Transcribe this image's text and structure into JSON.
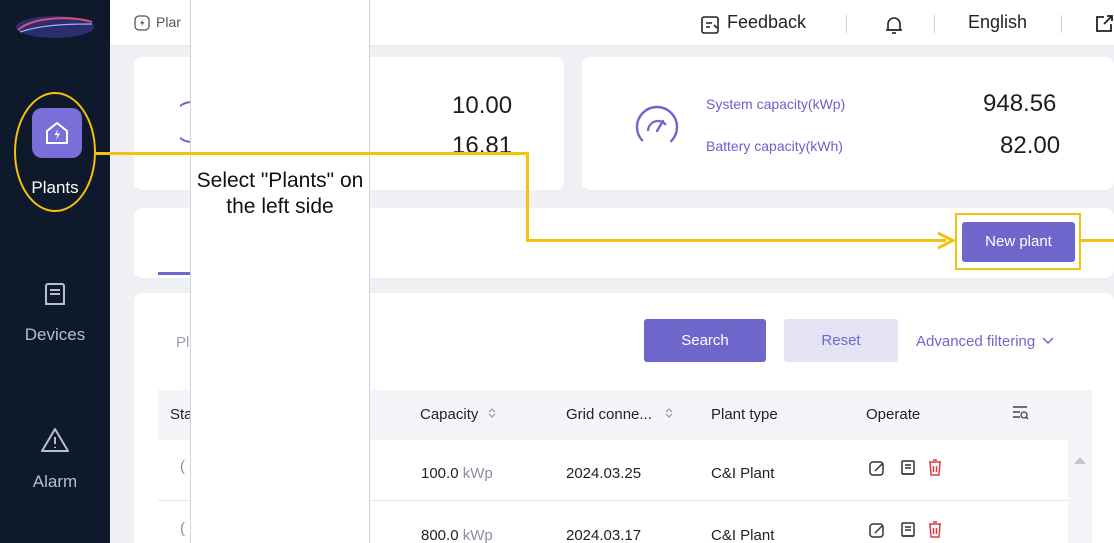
{
  "breadcrumb": "Plar",
  "topbar": {
    "feedback": "Feedback",
    "language": "English"
  },
  "sidebar": {
    "items": [
      {
        "label": "Plants"
      },
      {
        "label": "Devices"
      },
      {
        "label": "Alarm"
      }
    ]
  },
  "stats": {
    "left_value_1": "10.00",
    "left_value_2": "16.81",
    "system_capacity_label": "System capacity(kWp)",
    "system_capacity_value": "948.56",
    "battery_capacity_label": "Battery capacity(kWh)",
    "battery_capacity_value": "82.00"
  },
  "actions": {
    "new_plant": "New plant",
    "search": "Search",
    "reset": "Reset",
    "advanced_filtering": "Advanced filtering"
  },
  "filter": {
    "partial_placeholder": "Pl"
  },
  "table": {
    "headers": {
      "status_partial": "Sta",
      "capacity": "Capacity",
      "grid_connection": "Grid conne...",
      "plant_type": "Plant type",
      "operate": "Operate"
    },
    "rows": [
      {
        "capacity": "100.0",
        "unit": "kWp",
        "grid_date": "2024.03.25",
        "plant_type": "C&I Plant"
      },
      {
        "capacity": "800.0",
        "unit": "kWp",
        "grid_date": "2024.03.17",
        "plant_type": "C&I Plant"
      }
    ]
  },
  "tutorial": {
    "instruction": "Select \"Plants\" on the left side",
    "highlight_color": "#f4c20d"
  },
  "colors": {
    "accent": "#6f66cc",
    "sidebar_bg": "#0e1a2b",
    "delete": "#e0393e"
  }
}
